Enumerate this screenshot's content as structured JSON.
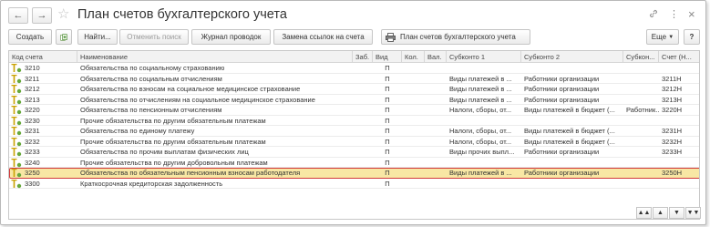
{
  "window": {
    "title": "План счетов бухгалтерского учета",
    "icons": {
      "link": "link-icon",
      "menu": "more-vertical-icon",
      "close": "close-icon",
      "favorite": "star-icon"
    }
  },
  "nav": {
    "back": "←",
    "forward": "→"
  },
  "toolbar": {
    "create": "Создать",
    "find": "Найти...",
    "cancel_search": "Отменить поиск",
    "journal": "Журнал проводок",
    "replace_links": "Замена ссылок на счета",
    "chart_of_accounts": "План счетов бухгалтерского учета",
    "more": "Еще",
    "help": "?"
  },
  "table": {
    "columns": [
      "Код счета",
      "Наименование",
      "Заб.",
      "Вид",
      "Кол.",
      "Вал.",
      "Субконто 1",
      "Субконто 2",
      "Субкон...",
      "Счет (Н..."
    ],
    "rows": [
      {
        "code": "3210",
        "name": "Обязательства по социальному страхованию",
        "zab": "",
        "vid": "П",
        "kol": "",
        "val": "",
        "s1": "",
        "s2": "",
        "s3": "",
        "nu": ""
      },
      {
        "code": "3211",
        "name": "Обязательства по социальным отчислениям",
        "zab": "",
        "vid": "П",
        "kol": "",
        "val": "",
        "s1": "Виды платежей в ...",
        "s2": "Работники организации",
        "s3": "",
        "nu": "3211Н"
      },
      {
        "code": "3212",
        "name": "Обязательства по взносам на социальное медицинское страхование",
        "zab": "",
        "vid": "П",
        "kol": "",
        "val": "",
        "s1": "Виды платежей в ...",
        "s2": "Работники организации",
        "s3": "",
        "nu": "3212Н"
      },
      {
        "code": "3213",
        "name": "Обязательства по отчислениям на социальное медицинское страхование",
        "zab": "",
        "vid": "П",
        "kol": "",
        "val": "",
        "s1": "Виды платежей в ...",
        "s2": "Работники организации",
        "s3": "",
        "nu": "3213Н"
      },
      {
        "code": "3220",
        "name": "Обязательства по пенсионным отчислениям",
        "zab": "",
        "vid": "П",
        "kol": "",
        "val": "",
        "s1": "Налоги, сборы, от...",
        "s2": "Виды платежей в бюджет (...",
        "s3": "Работник...",
        "nu": "3220Н"
      },
      {
        "code": "3230",
        "name": "Прочие обязательства по другим обязательным платежам",
        "zab": "",
        "vid": "П",
        "kol": "",
        "val": "",
        "s1": "",
        "s2": "",
        "s3": "",
        "nu": ""
      },
      {
        "code": "3231",
        "name": "Обязательства по единому платежу",
        "zab": "",
        "vid": "П",
        "kol": "",
        "val": "",
        "s1": "Налоги, сборы, от...",
        "s2": "Виды платежей в бюджет (...",
        "s3": "",
        "nu": "3231Н"
      },
      {
        "code": "3232",
        "name": "Прочие обязательства по другим обязательным платежам",
        "zab": "",
        "vid": "П",
        "kol": "",
        "val": "",
        "s1": "Налоги, сборы, от...",
        "s2": "Виды платежей в бюджет (...",
        "s3": "",
        "nu": "3232Н"
      },
      {
        "code": "3233",
        "name": "Обязательства по прочим выплатам физических лиц",
        "zab": "",
        "vid": "П",
        "kol": "",
        "val": "",
        "s1": "Виды прочих выпл...",
        "s2": "Работники организации",
        "s3": "",
        "nu": "3233Н"
      },
      {
        "code": "3240",
        "name": "Прочие обязательства по другим добровольным платежам",
        "zab": "",
        "vid": "П",
        "kol": "",
        "val": "",
        "s1": "",
        "s2": "",
        "s3": "",
        "nu": ""
      },
      {
        "code": "3250",
        "name": "Обязательства по обязательным пенсионным взносам работодателя",
        "zab": "",
        "vid": "П",
        "kol": "",
        "val": "",
        "s1": "Виды платежей в ...",
        "s2": "Работники организации",
        "s3": "",
        "nu": "3250Н",
        "selected": true
      },
      {
        "code": "3300",
        "name": "Краткосрочная кредиторская задолженность",
        "zab": "",
        "vid": "П",
        "kol": "",
        "val": "",
        "s1": "",
        "s2": "",
        "s3": "",
        "nu": ""
      }
    ]
  },
  "scroll_buttons": [
    "▲▲",
    "▲",
    "▼",
    "▼▼"
  ]
}
